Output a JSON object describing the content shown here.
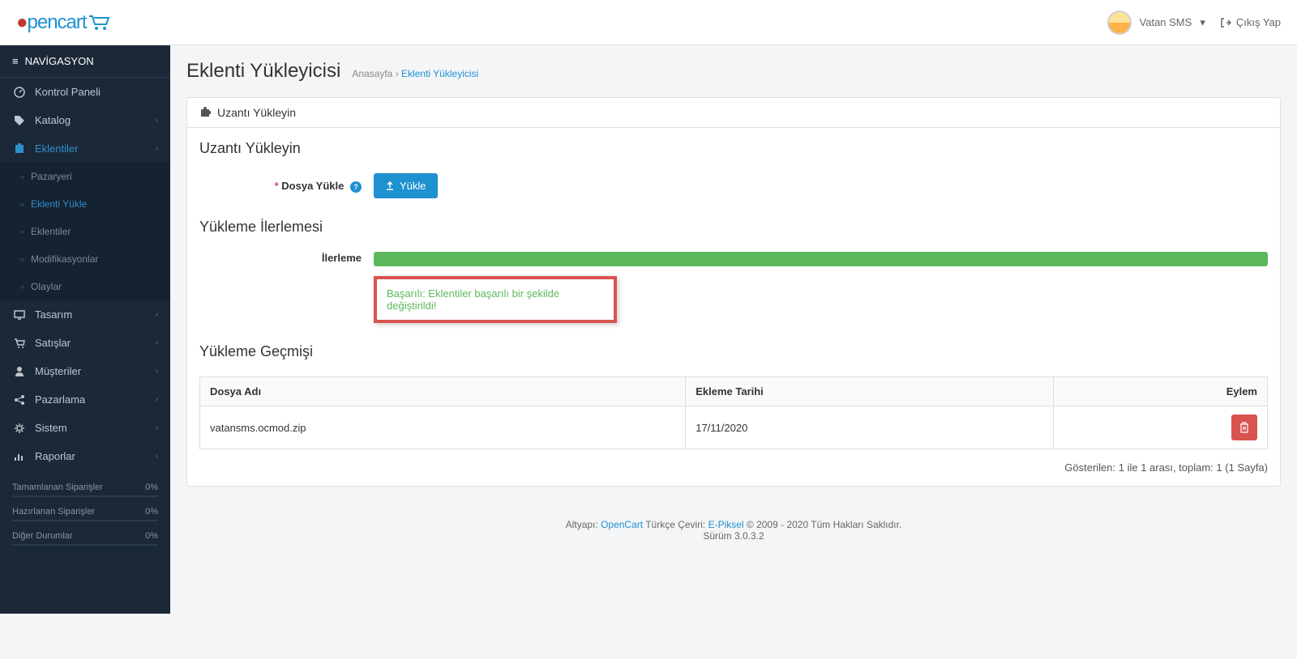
{
  "header": {
    "user_name": "Vatan SMS",
    "logout_label": "Çıkış Yap"
  },
  "sidebar": {
    "title": "NAVİGASYON",
    "items": [
      {
        "label": "Kontrol Paneli"
      },
      {
        "label": "Katalog"
      },
      {
        "label": "Eklentiler"
      },
      {
        "label": "Tasarım"
      },
      {
        "label": "Satışlar"
      },
      {
        "label": "Müşteriler"
      },
      {
        "label": "Pazarlama"
      },
      {
        "label": "Sistem"
      },
      {
        "label": "Raporlar"
      }
    ],
    "sub_items": [
      {
        "label": "Pazaryeri"
      },
      {
        "label": "Eklenti Yükle"
      },
      {
        "label": "Eklentiler"
      },
      {
        "label": "Modifikasyonlar"
      },
      {
        "label": "Olaylar"
      }
    ],
    "stats": [
      {
        "label": "Tamamlanan Siparişler",
        "value": "0%"
      },
      {
        "label": "Hazırlanan Siparişler",
        "value": "0%"
      },
      {
        "label": "Diğer Durumlar",
        "value": "0%"
      }
    ]
  },
  "page": {
    "title": "Eklenti Yükleyicisi",
    "breadcrumb_home": "Anasayfa",
    "breadcrumb_sep": "›",
    "breadcrumb_current": "Eklenti Yükleyicisi"
  },
  "panel": {
    "heading": "Uzantı Yükleyin",
    "upload_section_title": "Uzantı Yükleyin",
    "upload_label": "Dosya Yükle",
    "upload_button": "Yükle",
    "progress_section_title": "Yükleme İlerlemesi",
    "progress_label": "İlerleme",
    "alert_message": "Başarılı: Eklentiler başarılı bir şekilde değiştirildi!",
    "history_section_title": "Yükleme Geçmişi",
    "table": {
      "col_filename": "Dosya Adı",
      "col_date": "Ekleme Tarihi",
      "col_action": "Eylem",
      "rows": [
        {
          "filename": "vatansms.ocmod.zip",
          "date": "17/11/2020"
        }
      ]
    },
    "pagination_info": "Gösterilen: 1 ile 1 arası, toplam: 1 (1 Sayfa)"
  },
  "footer": {
    "prefix": "Altyapı: ",
    "link1": "OpenCart",
    "mid": " Türkçe Çeviri: ",
    "link2": "E-Piksel",
    "suffix": " © 2009 - 2020 Tüm Hakları Saklıdır.",
    "version": "Sürüm 3.0.3.2"
  }
}
